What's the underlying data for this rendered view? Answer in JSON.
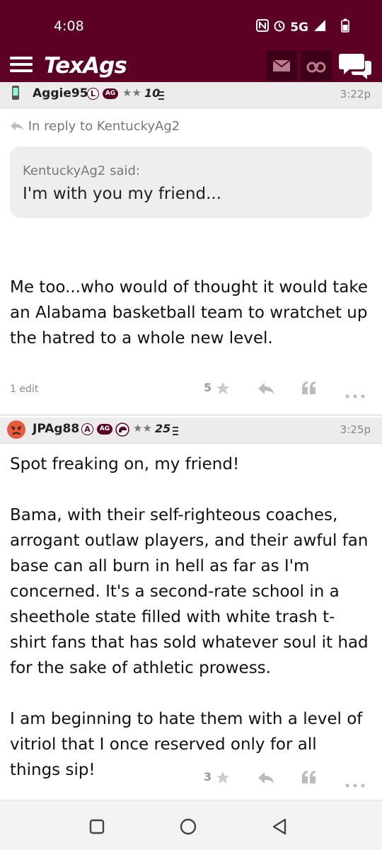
{
  "status_bar": {
    "time": "4:08",
    "network": "5G"
  },
  "header": {
    "app_name": "TexAgs",
    "icons": [
      "menu-icon",
      "mail-icon",
      "binoculars-icon",
      "chat-icon"
    ]
  },
  "posts": [
    {
      "username": "Aggie95",
      "badge_letter": "L",
      "ag_badge": "AG",
      "stars": "★★",
      "rank": "10",
      "time": "3:22p",
      "reply_to": "In reply to KentuckyAg2",
      "quote_author": "KentuckyAg2 said:",
      "quote_text": "I'm with you my friend...",
      "body": "Me too...who would of thought it would take an Alabama basketball team to wratchet up the hatred to a whole new level.",
      "edit_note": "1 edit",
      "star_count": "5"
    },
    {
      "username": "JPAg88",
      "badge_letter": "A",
      "ag_badge": "AG",
      "stars": "★★",
      "rank": "25",
      "time": "3:25p",
      "body": "Spot freaking on, my friend!\n\nBama, with their self-righteous coaches, arrogant outlaw players, and their awful fan base can all burn in hell as far as I'm concerned. It's a second-rate school in a sheethole state filled with white trash t-shirt fans that has sold whatever soul it had for the sake of athletic prowess.\n\nI am beginning to hate them with a level of vitriol that I once reserved only for all things sip!",
      "star_count": "3"
    }
  ]
}
